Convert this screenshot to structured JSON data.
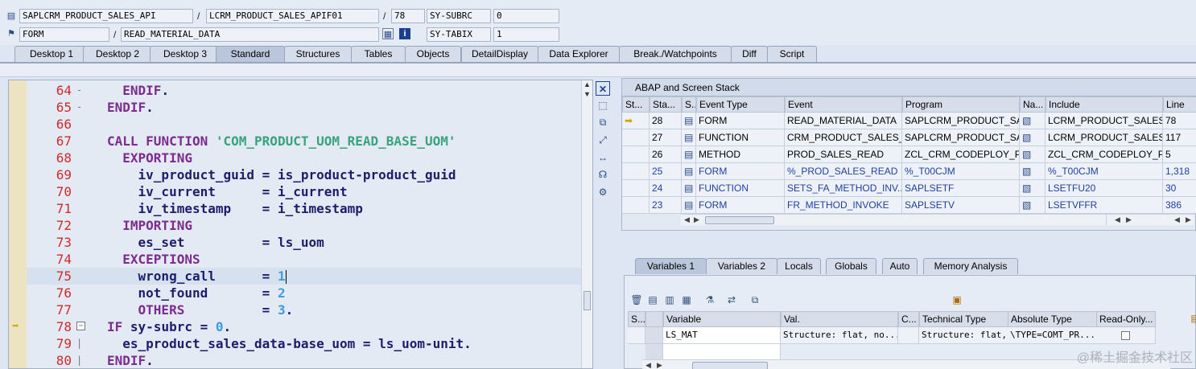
{
  "header": {
    "program": "SAPLCRM_PRODUCT_SALES_API",
    "include": "LCRM_PRODUCT_SALES_APIF01",
    "line": "78",
    "sy_subrc_label": "SY-SUBRC",
    "sy_subrc_value": "0",
    "event_type": "FORM",
    "event": "READ_MATERIAL_DATA",
    "sy_tabix_label": "SY-TABIX",
    "sy_tabix_value": "1",
    "sep1": "/",
    "sep2": "/",
    "sep3": "/",
    "sep4": "/"
  },
  "tabs": [
    "Desktop 1",
    "Desktop 2",
    "Desktop 3",
    "Standard",
    "Structures",
    "Tables",
    "Objects",
    "DetailDisplay",
    "Data Explorer",
    "Break./Watchpoints",
    "Diff",
    "Script"
  ],
  "active_tab": "Standard",
  "code_lines": [
    {
      "num": "64",
      "text": "  ENDIF."
    },
    {
      "num": "65",
      "text": "ENDIF."
    },
    {
      "num": "66",
      "text": ""
    },
    {
      "num": "67",
      "text": "CALL FUNCTION 'COM_PRODUCT_UOM_READ_BASE_UOM'"
    },
    {
      "num": "68",
      "text": "  EXPORTING"
    },
    {
      "num": "69",
      "text": "    iv_product_guid = is_product-product_guid"
    },
    {
      "num": "70",
      "text": "    iv_current      = i_current"
    },
    {
      "num": "71",
      "text": "    iv_timestamp    = i_timestamp"
    },
    {
      "num": "72",
      "text": "  IMPORTING"
    },
    {
      "num": "73",
      "text": "    es_set          = ls_uom"
    },
    {
      "num": "74",
      "text": "  EXCEPTIONS"
    },
    {
      "num": "75",
      "text": "    wrong_call      = 1"
    },
    {
      "num": "76",
      "text": "    not_found       = 2"
    },
    {
      "num": "77",
      "text": "    OTHERS          = 3."
    },
    {
      "num": "78",
      "text": "IF sy-subrc = 0."
    },
    {
      "num": "79",
      "text": "  es_product_sales_data-base_uom = ls_uom-unit."
    },
    {
      "num": "80",
      "text": "ENDIF."
    }
  ],
  "stack": {
    "title": "ABAP and Screen Stack",
    "columns": [
      "St...",
      "Sta...",
      "S...",
      "Event Type",
      "Event",
      "Program",
      "Na...",
      "Include",
      "Line"
    ],
    "rows": [
      {
        "level": "28",
        "type": "FORM",
        "event": "READ_MATERIAL_DATA",
        "program": "SAPLCRM_PRODUCT_SA...",
        "include": "LCRM_PRODUCT_SALES...",
        "line": "78",
        "current": true
      },
      {
        "level": "27",
        "type": "FUNCTION",
        "event": "CRM_PRODUCT_SALES_...",
        "program": "SAPLCRM_PRODUCT_SA...",
        "include": "LCRM_PRODUCT_SALES...",
        "line": "117",
        "current": false
      },
      {
        "level": "26",
        "type": "METHOD",
        "event": "PROD_SALES_READ",
        "program": "ZCL_CRM_CODEPLOY_P...",
        "include": "ZCL_CRM_CODEPLOY_P...",
        "line": "5",
        "current": false
      },
      {
        "level": "25",
        "type": "FORM",
        "event": "%_PROD_SALES_READ",
        "program": "%_T00CJM",
        "include": "%_T00CJM",
        "line": "1,318",
        "current": false
      },
      {
        "level": "24",
        "type": "FUNCTION",
        "event": "SETS_FA_METHOD_INV...",
        "program": "SAPLSETF",
        "include": "LSETFU20",
        "line": "30",
        "current": false
      },
      {
        "level": "23",
        "type": "FORM",
        "event": "FR_METHOD_INVOKE",
        "program": "SAPLSETV",
        "include": "LSETVFFR",
        "line": "386",
        "current": false
      }
    ]
  },
  "var_tabs": [
    "Variables 1",
    "Variables 2",
    "Locals",
    "Globals",
    "Auto",
    "Memory Analysis"
  ],
  "active_var_tab": "Variables 1",
  "variables": {
    "columns": [
      "S...",
      "Variable",
      "Val.",
      "C...",
      "Technical Type",
      "Absolute Type",
      "Read-Only..."
    ],
    "rows": [
      {
        "variable": "LS_MAT",
        "value": "Structure: flat, no...",
        "technical": "Structure: flat, no...",
        "absolute": "\\TYPE=COMT_PR..."
      }
    ]
  },
  "watermark": "@稀土掘金技术社区",
  "colors": {
    "keyword": "#7b2c8e",
    "identifier": "#1d1d6b",
    "string": "#39a37e",
    "number": "#3d9ce0",
    "line_number": "#d12a2a"
  }
}
